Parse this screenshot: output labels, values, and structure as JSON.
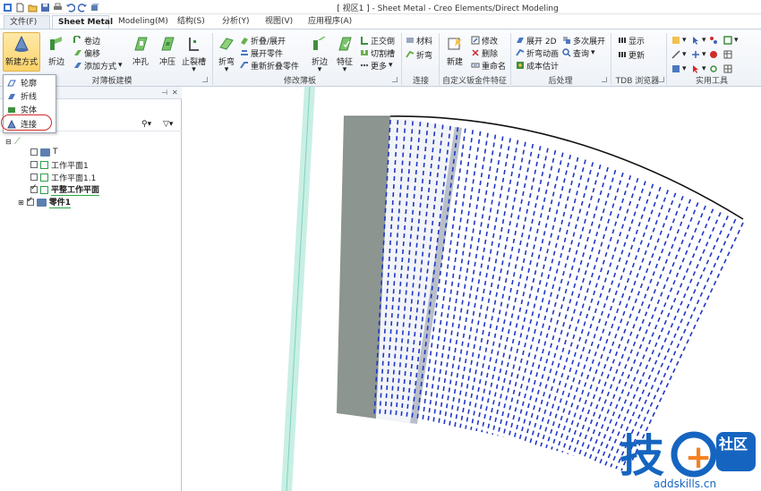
{
  "window": {
    "title": "[ 视区1 ] - Sheet Metal - Creo Elements/Direct Modeling"
  },
  "tabs": [
    {
      "label": "文件(F)"
    },
    {
      "label": "Sheet Metal"
    },
    {
      "label": "Modeling(M)"
    },
    {
      "label": "结构(S)"
    },
    {
      "label": "分析(Y)"
    },
    {
      "label": "视图(V)"
    },
    {
      "label": "应用程序(A)"
    }
  ],
  "ribbon": {
    "new_method": "新建方式",
    "fold_edge": "折边",
    "roll": "卷边",
    "offset": "偏移",
    "add_method": "添加方式",
    "punch": "冲孔",
    "stamp": "冲压",
    "relief": "止裂槽",
    "bend": "折弯",
    "fold_unfold": "折叠/展开",
    "unfold_part": "展开零件",
    "refold_part": "重新折叠零件",
    "fold_edge2": "折边",
    "feature": "特征",
    "orthogonal": "正交倒",
    "cut_slot": "切割槽",
    "more": "更多",
    "material": "材料",
    "fold_bend": "折弯",
    "new": "新建",
    "modify": "修改",
    "delete": "删除",
    "rename": "重命名",
    "unfold_2d": "展开 2D",
    "multi_unfold": "多次展开",
    "bend_anim": "折弯动画",
    "query": "查询",
    "cost_est": "成本估计",
    "display": "显示",
    "update": "更新",
    "groups": {
      "sheet_modeling": "对薄板建模",
      "modify_sheet": "修改薄板",
      "connect": "连接",
      "custom_features": "自定义钣金件特征",
      "post_process": "后处理",
      "tdb_browser": "TDB 浏览器",
      "utilities": "实用工具"
    }
  },
  "dropdown": {
    "items": [
      {
        "label": "轮廓"
      },
      {
        "label": "折线"
      },
      {
        "label": "实体"
      },
      {
        "label": "连接"
      }
    ]
  },
  "tree": {
    "root": "T",
    "items": [
      {
        "label": "工作平面1"
      },
      {
        "label": "工作平面1.1"
      },
      {
        "label": "平整工作平面"
      },
      {
        "label": "零件1"
      }
    ]
  },
  "watermark": {
    "char": "技",
    "plus": "+",
    "brand": "社区",
    "url": "addskills.cn"
  },
  "colors": {
    "accent": "#fcd36a",
    "highlight_circle": "#d22b2b",
    "bend_lines": "#1f36c8",
    "logo_blue": "#1565c0"
  }
}
